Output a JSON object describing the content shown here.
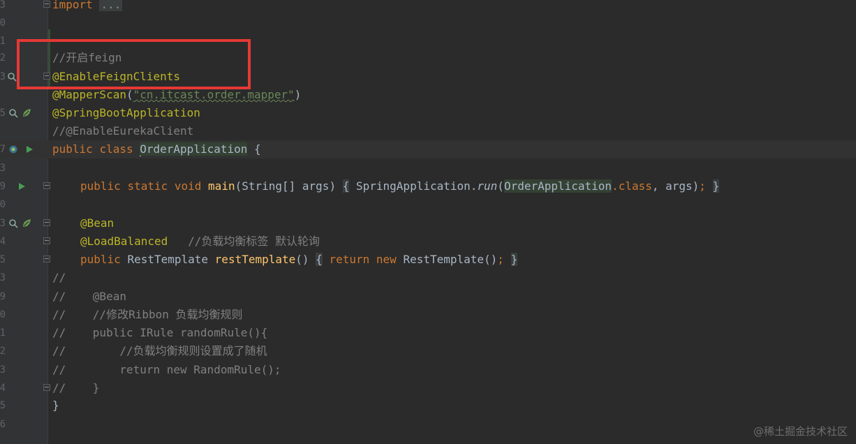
{
  "colors": {
    "background": "#2b2b2b",
    "keyword": "#cc7832",
    "annotation": "#bbb529",
    "comment": "#808080",
    "string": "#6a8759",
    "method": "#ffc66d",
    "text": "#a9b7c6",
    "highlight_box": "#e53935"
  },
  "line_numbers": [
    "3",
    "0",
    "1",
    "2",
    "3",
    "",
    "5",
    "",
    "7",
    "3",
    "9",
    "0",
    "3",
    "4",
    "5",
    "3",
    "9",
    "0",
    "1",
    "2",
    "3",
    "4",
    "5",
    "6"
  ],
  "code": {
    "import_kw": "import",
    "import_fold": "...",
    "comment_feign": "//开启feign",
    "ann_enable_feign": "@EnableFeignClients",
    "ann_mapper_scan": "@MapperScan",
    "mapper_scan_open": "(",
    "mapper_scan_arg": "\"cn.itcast.order.mapper\"",
    "mapper_scan_close": ")",
    "ann_spring_boot": "@SpringBootApplication",
    "comment_eureka": "//@EnableEurekaClient",
    "kw_public": "public",
    "kw_class": "class",
    "class_name": "OrderApplication",
    "open_brace": "{",
    "main_kw_public": "public",
    "main_kw_static": "static",
    "main_kw_void": "void",
    "main_name": "main",
    "main_params": "(String[] args)",
    "main_body_open": "{",
    "main_body_call": "SpringApplication.",
    "main_body_run": "run",
    "main_body_paren": "(",
    "main_body_cls": "OrderApplication",
    "main_body_dotclass": ".class",
    "main_body_rest": ", args)",
    "main_body_semi": ";",
    "main_body_close": "}",
    "ann_bean": "@Bean",
    "ann_load_balanced": "@LoadBalanced",
    "comment_lb": "//负载均衡标签 默认轮询",
    "rt_kw_public": "public",
    "rt_type": "RestTemplate",
    "rt_name": "restTemplate",
    "rt_parens": "()",
    "rt_open": "{",
    "rt_return": "return",
    "rt_new": "new",
    "rt_ctor": "RestTemplate()",
    "rt_semi": ";",
    "rt_close": "}",
    "c1": "//",
    "c2": "//    @Bean",
    "c3": "//    //修改Ribbon 负载均衡规则",
    "c4": "//    public IRule randomRule(){",
    "c5": "//        //负载均衡规则设置成了随机",
    "c6": "//        return new RandomRule();",
    "c7": "//    }",
    "close_brace": "}"
  },
  "watermark": "@稀土掘金技术社区"
}
